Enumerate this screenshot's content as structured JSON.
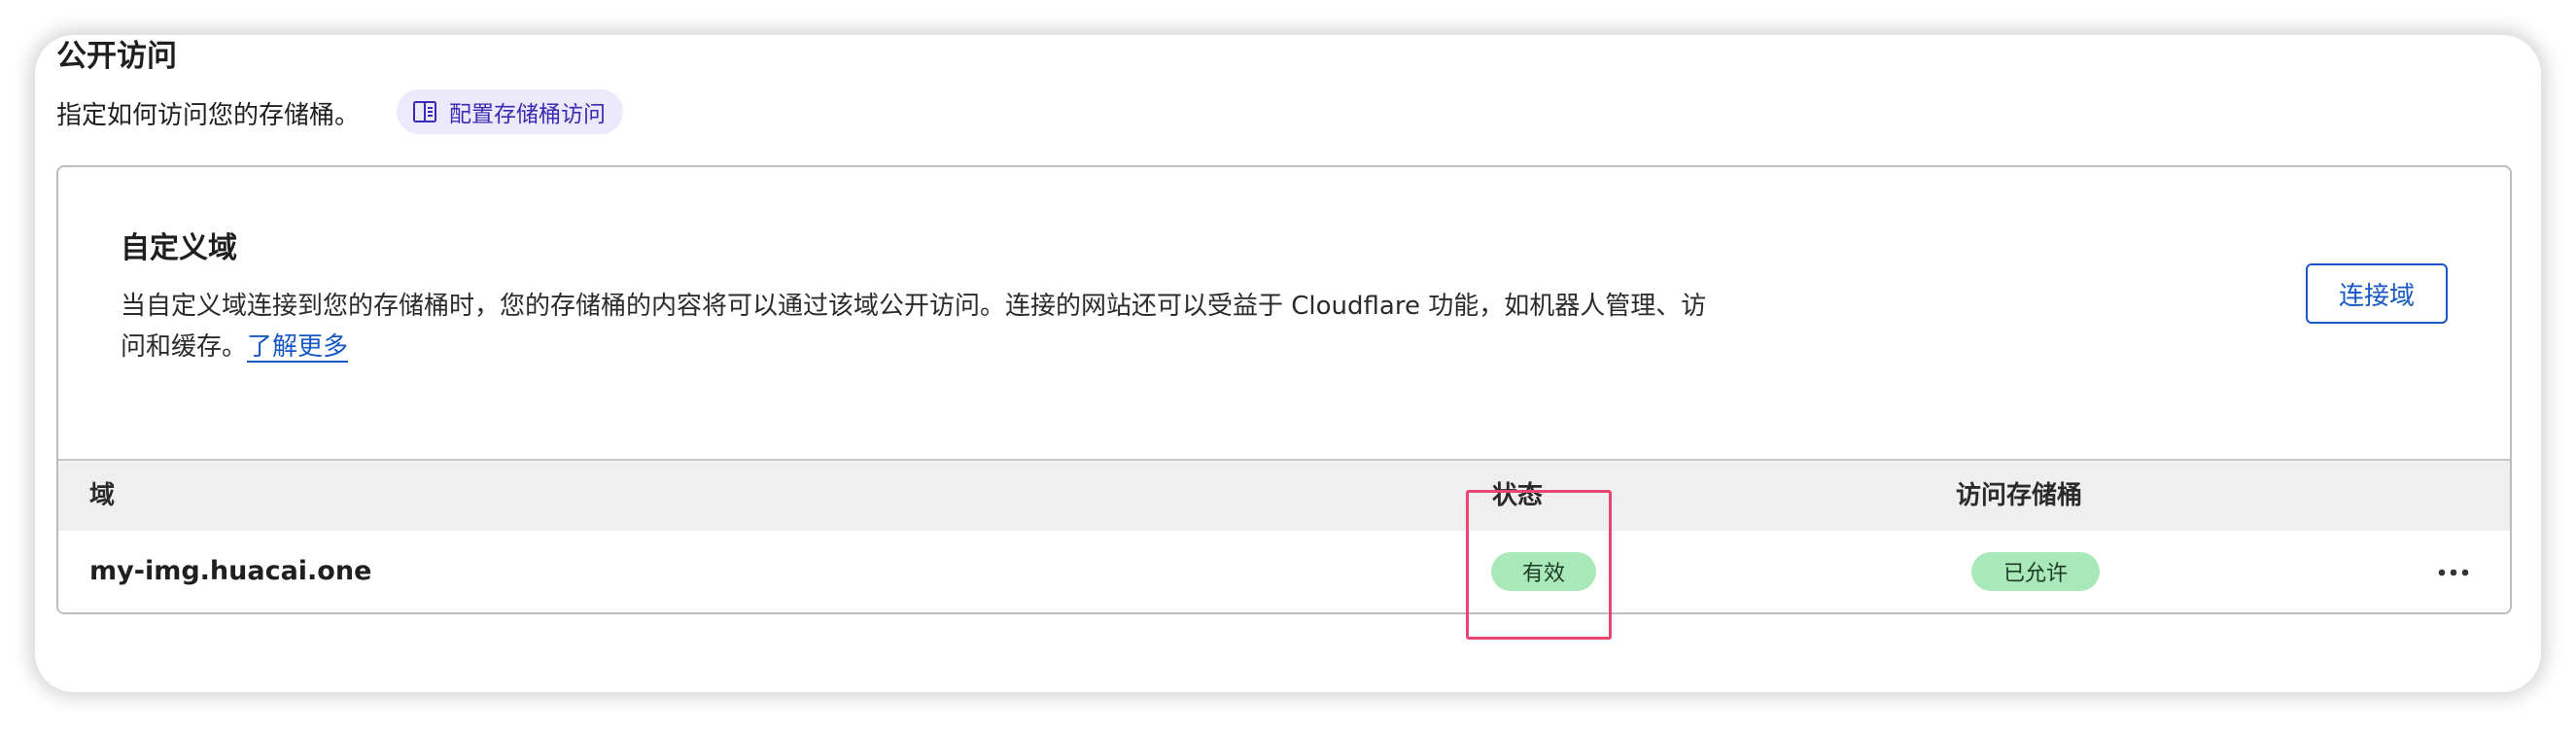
{
  "public_access": {
    "title": "公开访问",
    "description": "指定如何访问您的存储桶。",
    "doc_link_label": "配置存储桶访问"
  },
  "custom_domain": {
    "title": "自定义域",
    "description": "当自定义域连接到您的存储桶时，您的存储桶的内容将可以通过该域公开访问。连接的网站还可以受益于 Cloudflare 功能，如机器人管理、访问和缓存。",
    "learn_more_label": "了解更多",
    "connect_button_label": "连接域"
  },
  "table": {
    "headers": {
      "domain": "域",
      "status": "状态",
      "bucket_access": "访问存储桶"
    },
    "rows": [
      {
        "domain": "my-img.huacai.one",
        "status": "有效",
        "bucket_access": "已允许"
      }
    ]
  },
  "colors": {
    "accent": "#1758c4",
    "link_pill_bg": "#ece9fb",
    "link_pill_text": "#3a2bb4",
    "badge_bg": "#a9e8b8",
    "highlight": "#e8466f"
  },
  "icons": {
    "doc_link": "book-open-icon",
    "row_menu": "more-horizontal-icon"
  }
}
